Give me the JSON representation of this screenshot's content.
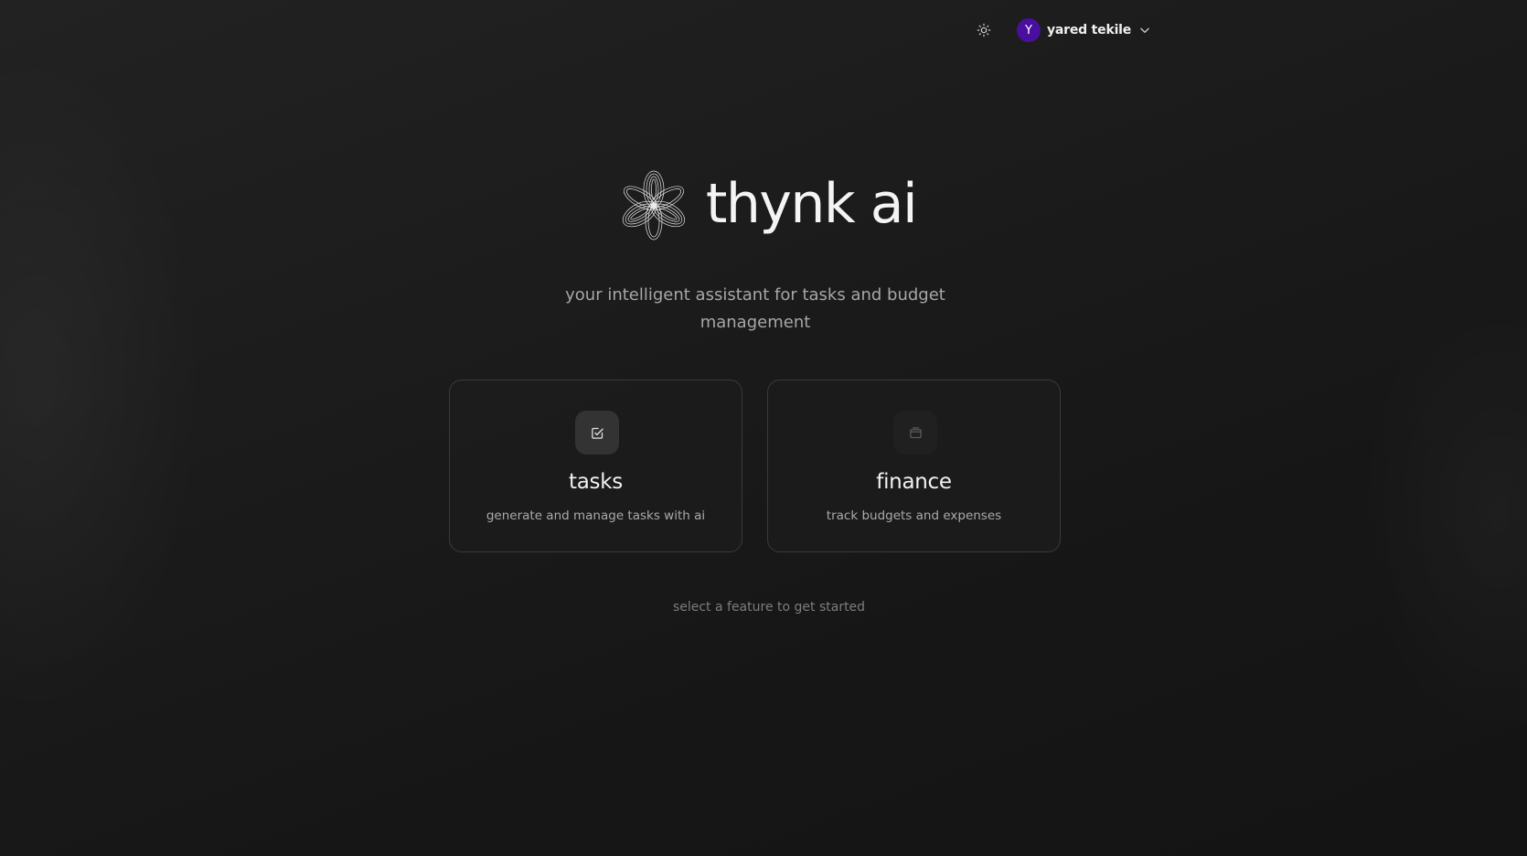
{
  "header": {
    "theme_toggle_icon": "sun-icon",
    "user": {
      "avatar_initial": "Y",
      "avatar_color": "#4b0fa0",
      "name": "yared tekile",
      "menu_icon": "chevron-down-icon"
    }
  },
  "hero": {
    "logo_icon": "flower-logo-icon",
    "brand_name": "thynk ai",
    "tagline": "your intelligent assistant for tasks and budget management"
  },
  "features": [
    {
      "icon": "checkbox-edit-icon",
      "title": "tasks",
      "description": "generate and manage tasks with ai"
    },
    {
      "icon": "wallet-icon",
      "title": "finance",
      "description": "track budgets and expenses"
    }
  ],
  "hint": "select a feature to get started"
}
